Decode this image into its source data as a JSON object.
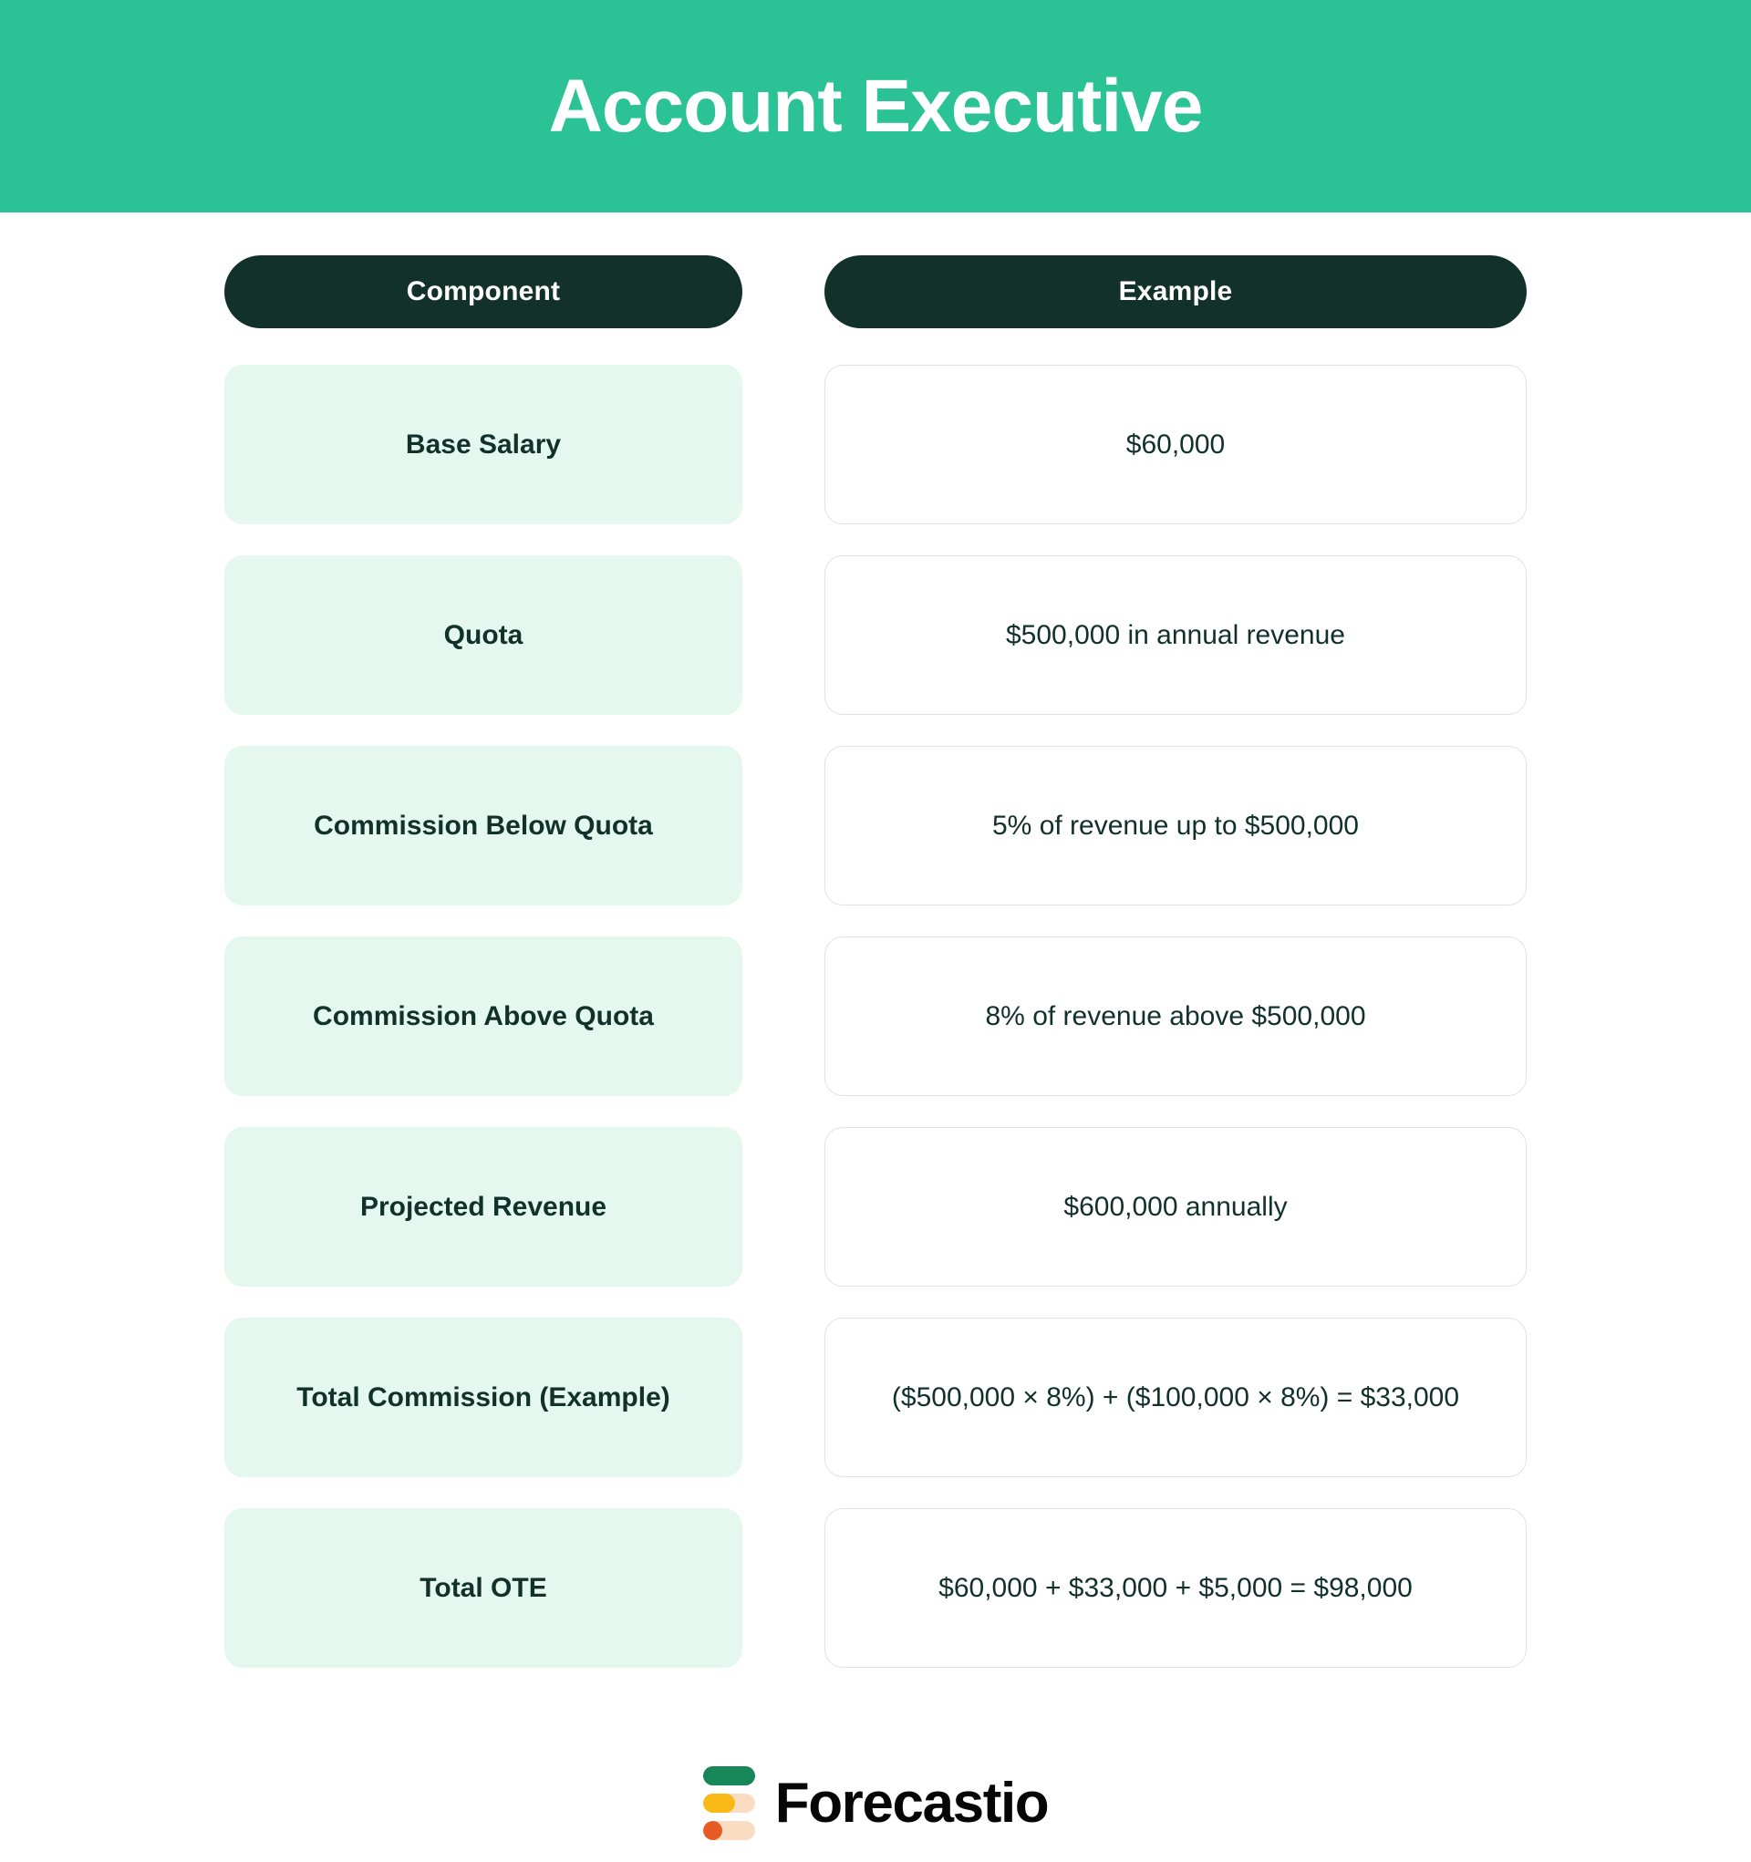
{
  "banner": {
    "title": "Account Executive",
    "background_color": "#2BC295",
    "text_color": "#FFFFFF"
  },
  "table": {
    "headers": {
      "component": "Component",
      "example": "Example"
    },
    "header_colors": {
      "pill_background": "#12312A",
      "pill_text": "#FFFFFF"
    },
    "cell_colors": {
      "component_background": "#E4F8F0",
      "component_text": "#12312A",
      "example_background": "#FFFFFF",
      "example_border": "#E1E3E2",
      "example_text": "#12312A"
    },
    "rows": [
      {
        "component": "Base Salary",
        "example": "$60,000"
      },
      {
        "component": "Quota",
        "example": "$500,000 in annual revenue"
      },
      {
        "component": "Commission Below Quota",
        "example": "5% of revenue up to $500,000"
      },
      {
        "component": "Commission Above Quota",
        "example": "8% of revenue above $500,000"
      },
      {
        "component": "Projected Revenue",
        "example": "$600,000 annually"
      },
      {
        "component": "Total Commission (Example)",
        "example": "($500,000 × 8%) + ($100,000 × 8%) = $33,000"
      },
      {
        "component": "Total OTE",
        "example": "$60,000 + $33,000 + $5,000 = $98,000"
      }
    ]
  },
  "footer": {
    "logo_text": "Forecastio",
    "logo_bars": [
      {
        "name": "green-bar",
        "fill_color": "#17875A",
        "track_color": "#17875A",
        "fill_percent": 100
      },
      {
        "name": "amber-bar",
        "fill_color": "#F9B916",
        "track_color": "#FADCC2",
        "fill_percent": 62
      },
      {
        "name": "orange-bar",
        "fill_color": "#E75B26",
        "track_color": "#FADCC2",
        "fill_percent": 37
      }
    ]
  }
}
